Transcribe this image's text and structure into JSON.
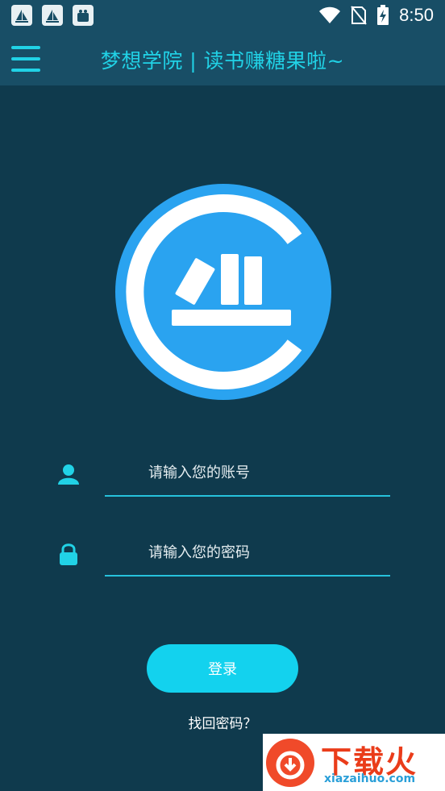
{
  "status_bar": {
    "time": "8:50",
    "left_icons": [
      "sailboat-icon",
      "sailboat-icon",
      "bag-icon"
    ],
    "right_icons": [
      "wifi-icon",
      "no-sim-icon",
      "battery-charging-icon"
    ]
  },
  "app_bar": {
    "title": "梦想学院 | 读书赚糖果啦~",
    "menu_icon": "hamburger-menu-icon"
  },
  "logo": {
    "icon": "bookshelf-c-logo",
    "color": "#2aa3f0"
  },
  "form": {
    "username": {
      "placeholder": "请输入您的账号",
      "value": "",
      "icon": "user-icon"
    },
    "password": {
      "placeholder": "请输入您的密码",
      "value": "",
      "icon": "lock-icon"
    },
    "login_label": "登录",
    "forgot_label": "找回密码？"
  },
  "watermark": {
    "cn": "下载火",
    "url": "xiazaihuo.com"
  },
  "colors": {
    "background": "#0f3a4d",
    "app_bar": "#184e66",
    "accent": "#21d2e6",
    "button": "#13d2ee",
    "logo": "#2aa3f0"
  }
}
